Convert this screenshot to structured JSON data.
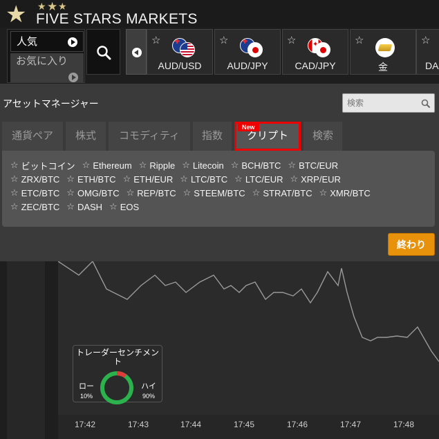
{
  "header": {
    "logo_text": "FIVE STARS MARKETS"
  },
  "nav": {
    "popular_label": "人気",
    "favorites_label": "お気に入り"
  },
  "assets": [
    {
      "label": "AUD/USD",
      "icon": "flag-au-us"
    },
    {
      "label": "AUD/JPY",
      "icon": "flag-au-jp"
    },
    {
      "label": "CAD/JPY",
      "icon": "flag-ca-jp"
    },
    {
      "label": "金",
      "icon": "gold-bar-icon"
    },
    {
      "label": "DAX",
      "icon": "index-icon"
    }
  ],
  "asset_manager": {
    "title": "アセットマネージャー",
    "search_placeholder": "検索",
    "tabs": [
      {
        "label": "通貨ペア"
      },
      {
        "label": "株式"
      },
      {
        "label": "コモディティ"
      },
      {
        "label": "指数"
      },
      {
        "label": "クリプト",
        "badge": "New",
        "active": true
      },
      {
        "label": "検索"
      }
    ],
    "crypto_rows": [
      [
        "ビットコイン",
        "Ethereum",
        "Ripple",
        "Litecoin",
        "BCH/BTC",
        "BTC/EUR"
      ],
      [
        "ZRX/BTC",
        "ETH/BTC",
        "ETH/EUR",
        "LTC/BTC",
        "LTC/EUR",
        "XRP/EUR"
      ],
      [
        "ETC/BTC",
        "OMG/BTC",
        "REP/BTC",
        "STEEM/BTC",
        "STRAT/BTC",
        "XMR/BTC"
      ],
      [
        "ZEC/BTC",
        "DASH",
        "EOS"
      ]
    ],
    "close_label": "終わり"
  },
  "chart": {
    "x_ticks": [
      "17:42",
      "17:43",
      "17:44",
      "17:45",
      "17:46",
      "17:47",
      "17:48"
    ],
    "line_color": "#9a9a9a"
  },
  "sentiment": {
    "title": "トレーダーセンチメント",
    "low_label": "ロー",
    "low_pct": "10%",
    "high_label": "ハイ",
    "high_pct": "90%",
    "low_value": 10,
    "high_value": 90,
    "colors": {
      "high": "#2bb24c",
      "low": "#e23b3b"
    }
  }
}
